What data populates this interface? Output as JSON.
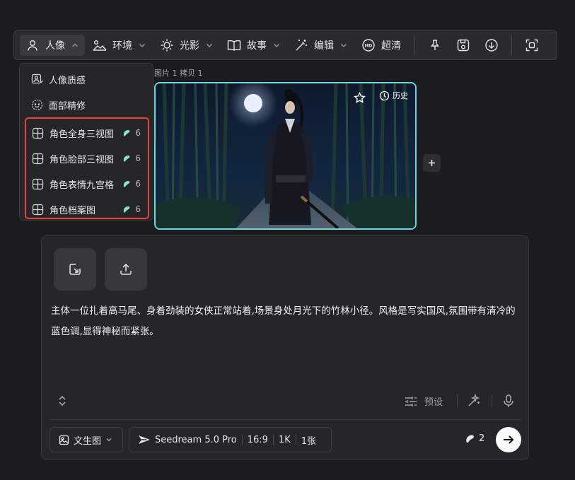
{
  "toolbar": {
    "items": [
      {
        "label": "人像",
        "icon": "person-icon",
        "expanded": true
      },
      {
        "label": "环境",
        "icon": "landscape-icon"
      },
      {
        "label": "光影",
        "icon": "sun-icon"
      },
      {
        "label": "故事",
        "icon": "book-icon"
      },
      {
        "label": "编辑",
        "icon": "magic-wand-icon"
      },
      {
        "label": "超清",
        "icon": "hd-icon"
      }
    ],
    "right_icons": [
      "pin-icon",
      "save-icon",
      "download-icon",
      "fullscreen-icon"
    ]
  },
  "dropdown": {
    "items": [
      {
        "label": "人像质感",
        "icon": "portrait-texture-icon"
      },
      {
        "label": "面部精修",
        "icon": "face-icon"
      },
      {
        "label": "角色全身三视图",
        "icon": "grid-icon",
        "cost": "6"
      },
      {
        "label": "角色脸部三视图",
        "icon": "grid-icon",
        "cost": "6"
      },
      {
        "label": "角色表情九宫格",
        "icon": "grid-icon",
        "cost": "6"
      },
      {
        "label": "角色档案图",
        "icon": "grid-icon",
        "cost": "6"
      }
    ]
  },
  "canvas": {
    "image_label": "图片 1 拷贝 1",
    "history_label": "历史"
  },
  "prompt": {
    "text": "主体一位扎着高马尾、身着劲装的女侠正常站着,场景身处月光下的竹林小径。风格是写实国风,氛围带有清冷的蓝色调,显得神秘而紧张。",
    "preset_label": "预设",
    "mode_label": "文生图",
    "model_name": "Seedream 5.0 Pro",
    "aspect_ratio": "16:9",
    "resolution": "1K",
    "count": "1张",
    "credits": "2"
  },
  "colors": {
    "accent_border": "#6fd3df",
    "highlight_border": "#e0463d",
    "credit_icon": "#8fe3c9"
  }
}
